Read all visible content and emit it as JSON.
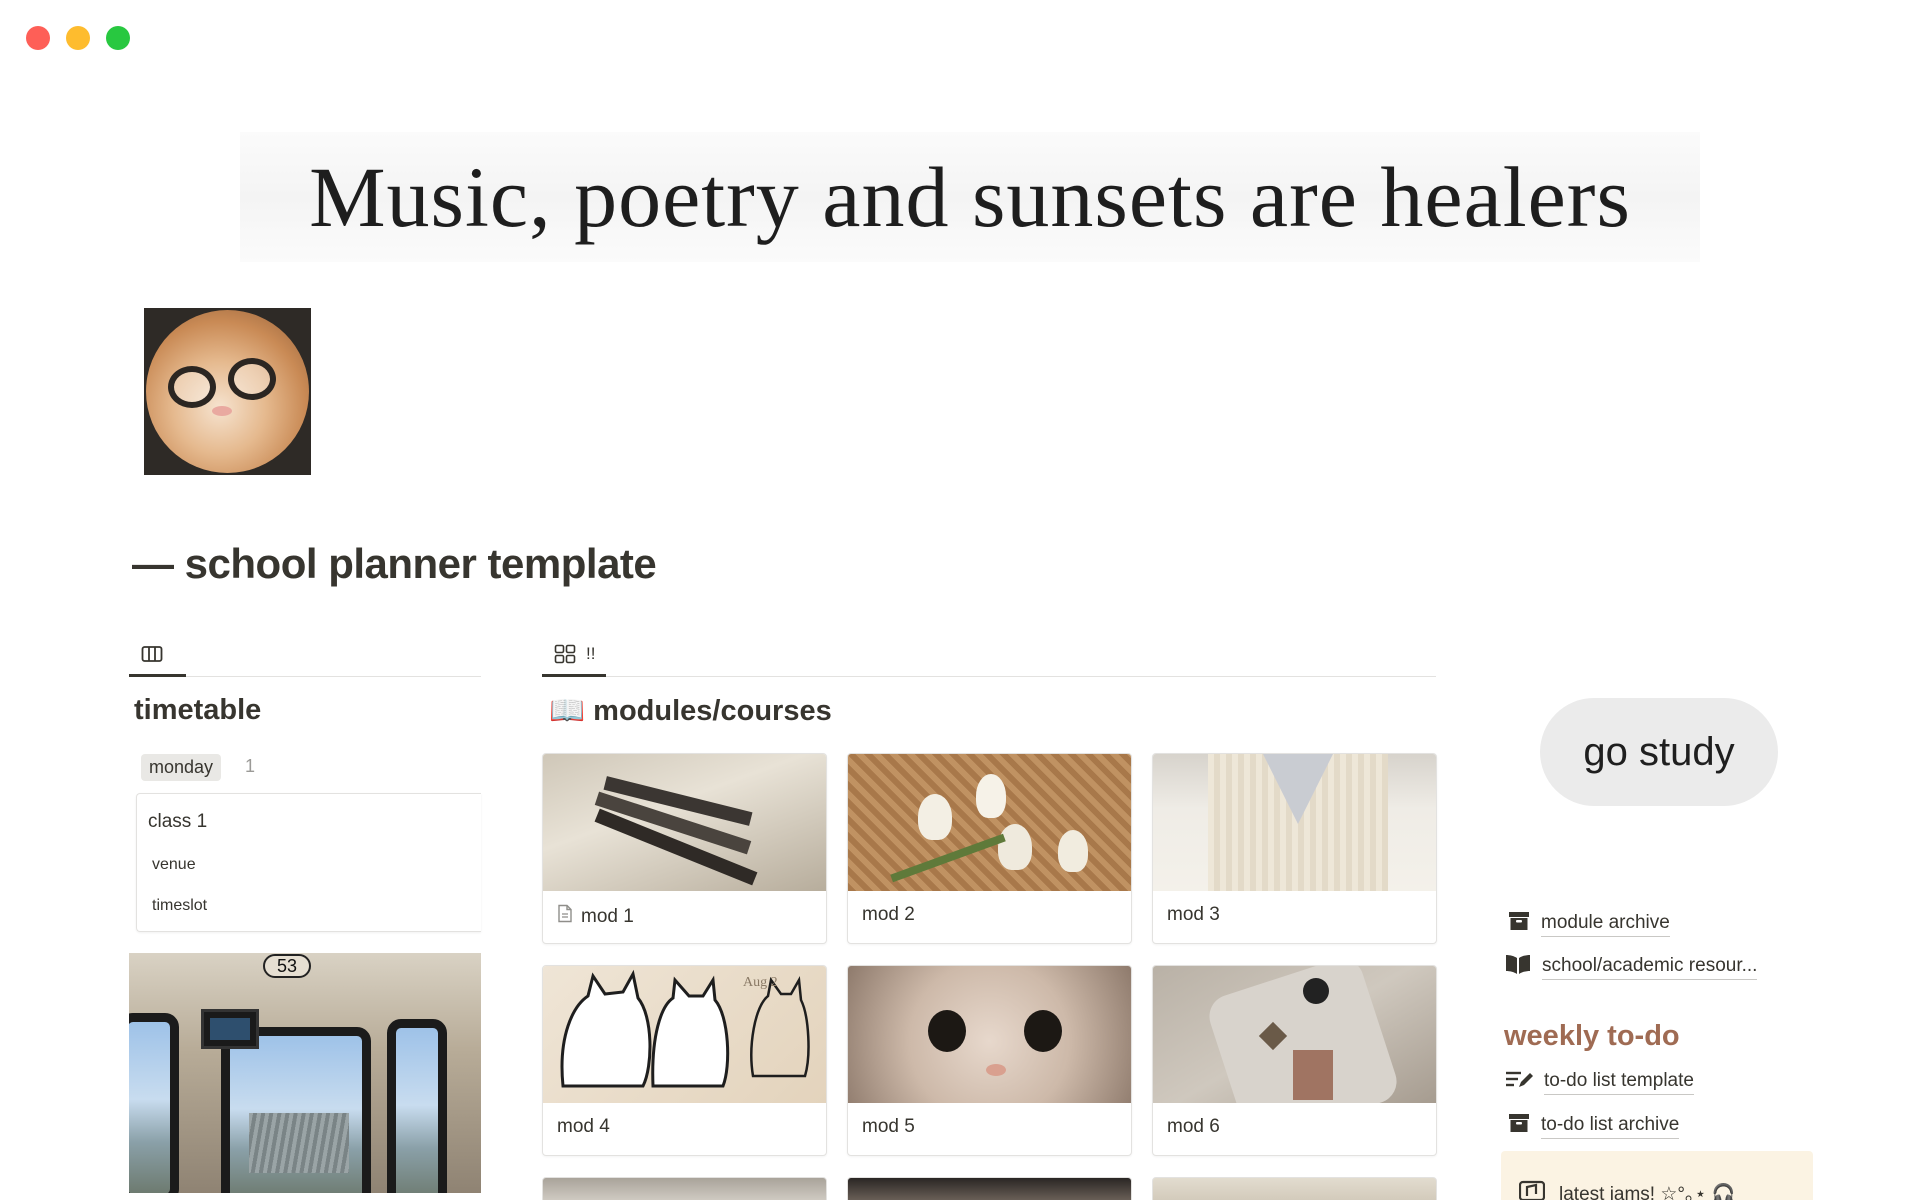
{
  "window": {
    "controls": [
      "close",
      "minimize",
      "maximize"
    ]
  },
  "banner": {
    "text": "Music, poetry and sunsets are healers"
  },
  "page": {
    "title": "— school planner template"
  },
  "left_view": {
    "tab_icon": "board-columns-icon"
  },
  "timetable": {
    "title": "timetable",
    "group": {
      "label": "monday",
      "count": "1"
    },
    "card": {
      "title": "class 1",
      "venue": "venue",
      "timeslot": "timeslot"
    },
    "image_badge": "53"
  },
  "modules_view": {
    "tab_icon": "gallery-grid-icon",
    "tab_label": "!!"
  },
  "modules": {
    "title_emoji": "📖",
    "title": "modules/courses",
    "cards": [
      {
        "label": "mod 1",
        "has_page_icon": true
      },
      {
        "label": "mod 2"
      },
      {
        "label": "mod 3"
      },
      {
        "label": "mod 4"
      },
      {
        "label": "mod 5"
      },
      {
        "label": "mod 6"
      }
    ]
  },
  "sidebar": {
    "go_study": "go study",
    "links": [
      {
        "label": "module archive",
        "icon": "archive-box-icon"
      },
      {
        "label": "school/academic resour...",
        "icon": "open-book-icon"
      }
    ],
    "weekly_heading": "weekly to-do",
    "todo_links": [
      {
        "label": "to-do list template",
        "icon": "list-edit-icon"
      },
      {
        "label": "to-do list archive",
        "icon": "archive-box-icon"
      }
    ],
    "callout": {
      "text": "latest jams! ☆°｡⋆ 🎧",
      "icon": "music-icon"
    }
  },
  "colors": {
    "accent_heading": "#9f6b53",
    "callout_bg": "#fbf3e3",
    "go_study_bg": "#ebebeb"
  }
}
